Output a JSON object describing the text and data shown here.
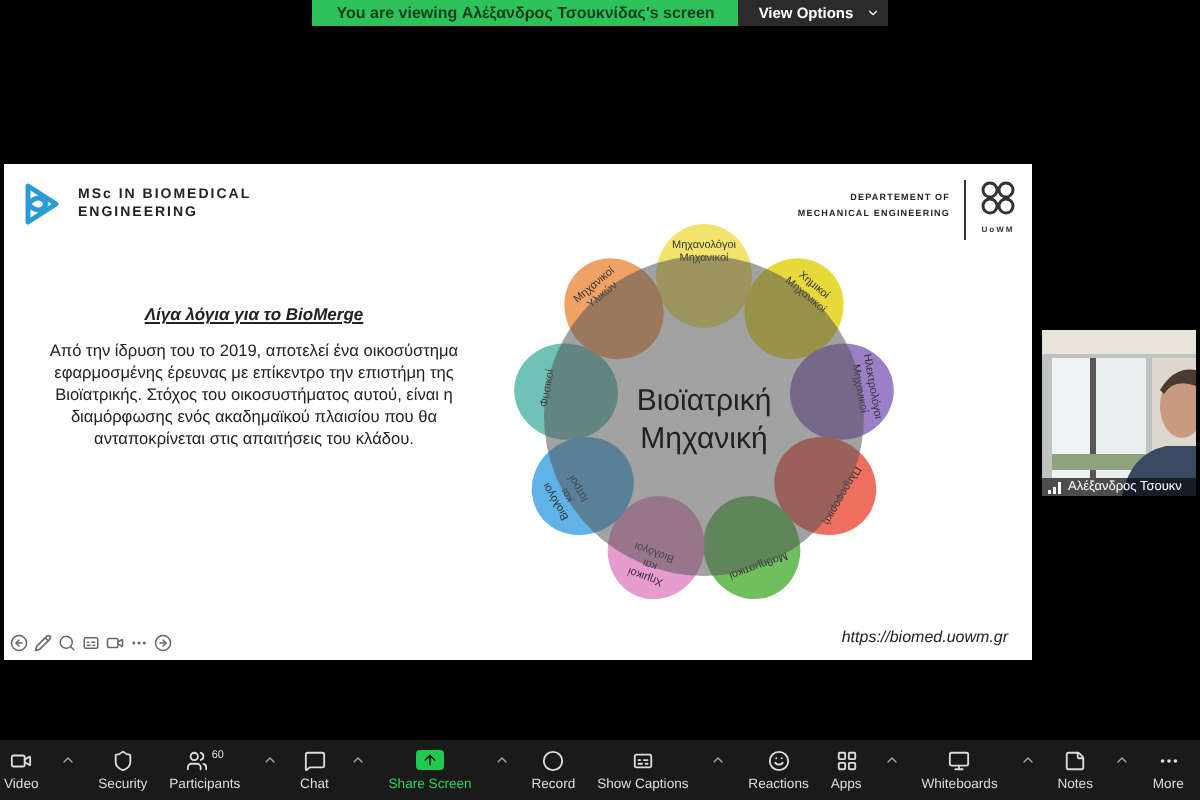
{
  "share_banner": {
    "message": "You are viewing Αλέξανδρος Τσουκνίδας's screen",
    "button": "View Options"
  },
  "slide": {
    "program_title": "MSc IN BIOMEDICAL ENGINEERING",
    "department": "DEPARTEMENT OF MECHANICAL ENGINEERING",
    "university": "UoWM",
    "heading": "Λίγα λόγια για το BioMerge",
    "paragraph": "Από την ίδρυση του το 2019, αποτελεί ένα οικοσύστημα εφαρμοσμένης έρευνας με επίκεντρο την επιστήμη της Βιοϊατρικής. Στόχος του οικοσυστήματος αυτού, είναι η διαμόρφωσης ενός ακαδημαϊκού πλαισίου που θα ανταποκρίνεται στις απαιτήσεις του κλάδου.",
    "diagram": {
      "center": "Βιοϊατρική Μηχανική",
      "petals": [
        {
          "label": "Μηχανολόγοι Μηχανικοί",
          "color": "#f3e36a"
        },
        {
          "label": "Χημικοί Μηχανικοί",
          "color": "#e8d93a"
        },
        {
          "label": "Ηλεκτρολόγοι Μηχανικοί",
          "color": "#9b7fc8"
        },
        {
          "label": "Πληροφορική",
          "color": "#ee6f5f"
        },
        {
          "label": "Μαθηματικοί",
          "color": "#6fbf5f"
        },
        {
          "label": "Χημικοί και Βιολόγοι",
          "color": "#e79bcf"
        },
        {
          "label": "Βιολόγοι και Ιατροί",
          "color": "#5fb3e6"
        },
        {
          "label": "Φυσικοί",
          "color": "#6fc2b6"
        },
        {
          "label": "Μηχανικοί Υλικών",
          "color": "#f0a266"
        }
      ]
    },
    "url": "https://biomed.uowm.gr"
  },
  "participant_video": {
    "name": "Αλέξανδρος Τσουκν"
  },
  "toolbar": [
    {
      "label": "Video",
      "caret": true
    },
    {
      "label": "Security",
      "caret": false
    },
    {
      "label": "Participants",
      "count": "60",
      "caret": true
    },
    {
      "label": "Chat",
      "caret": true
    },
    {
      "label": "Share Screen",
      "kind": "share",
      "caret": true
    },
    {
      "label": "Record",
      "caret": false
    },
    {
      "label": "Show Captions",
      "caret": true
    },
    {
      "label": "Reactions",
      "caret": false
    },
    {
      "label": "Apps",
      "caret": true
    },
    {
      "label": "Whiteboards",
      "caret": true
    },
    {
      "label": "Notes",
      "caret": true
    },
    {
      "label": "More",
      "caret": false
    }
  ]
}
